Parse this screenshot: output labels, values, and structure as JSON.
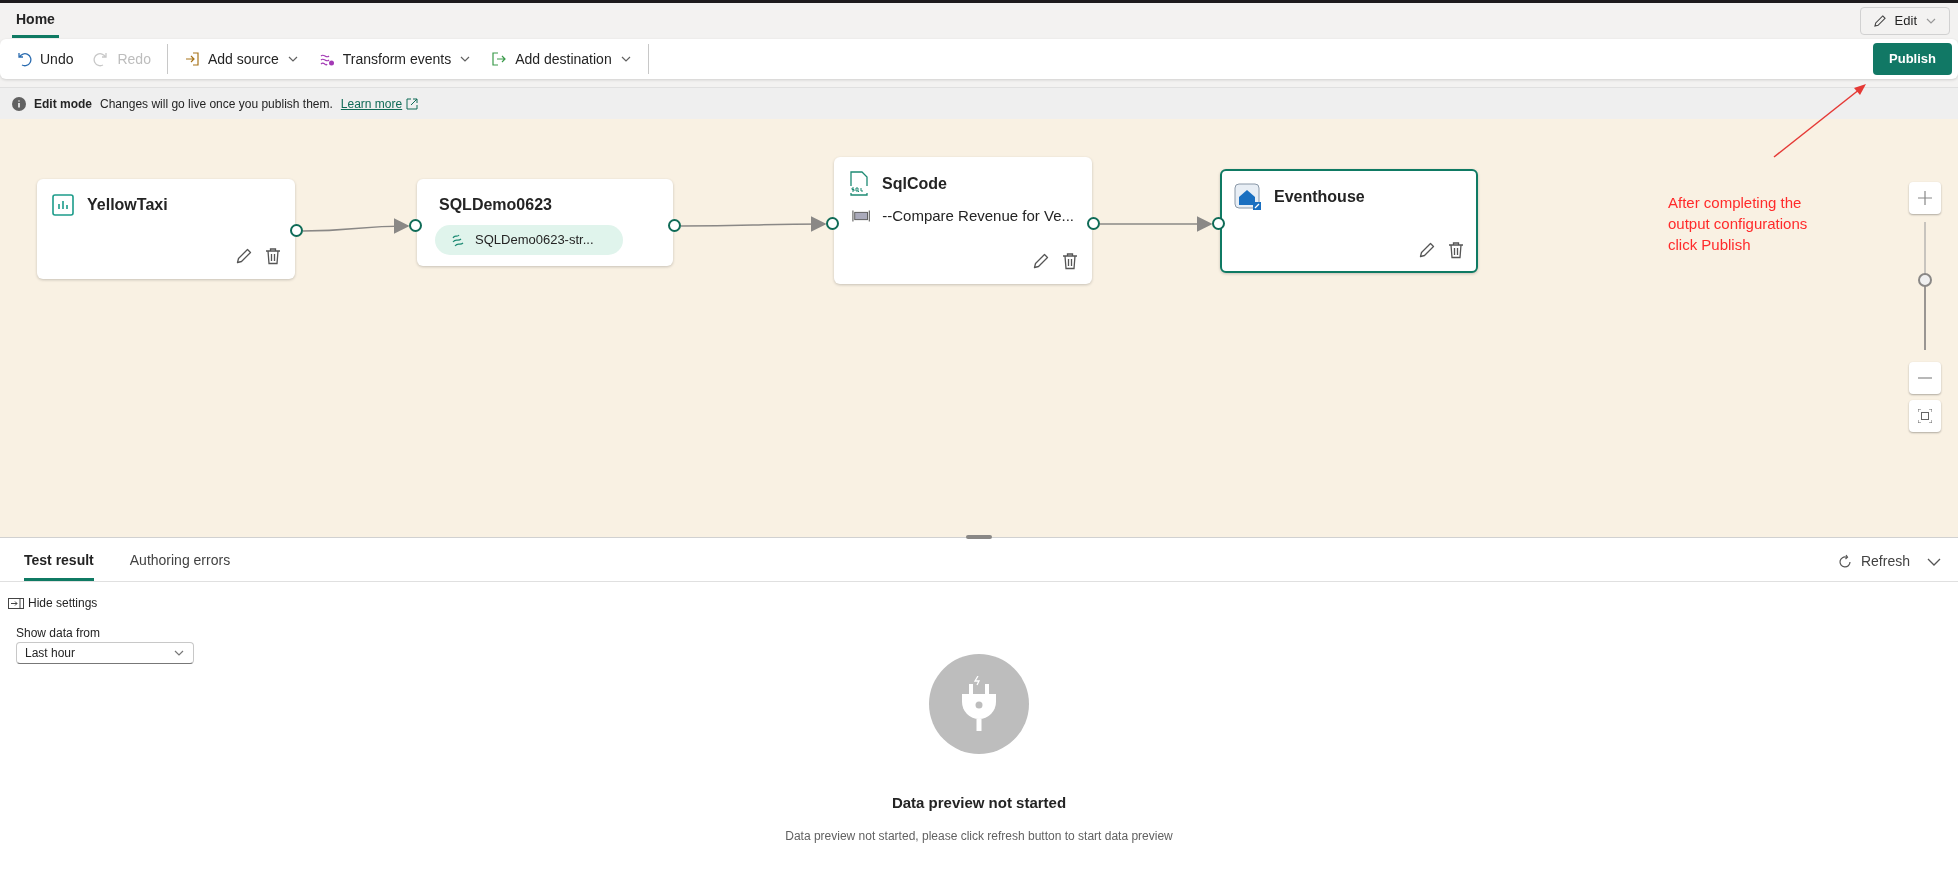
{
  "tabs": [
    {
      "label": "Home",
      "selected": true
    }
  ],
  "edit_button": {
    "label": "Edit"
  },
  "toolbar": {
    "groups": [
      [
        {
          "kind": "undo",
          "label": "Undo",
          "disabled": false,
          "dropdown": false
        },
        {
          "kind": "redo",
          "label": "Redo",
          "disabled": true,
          "dropdown": false
        }
      ],
      [
        {
          "kind": "source",
          "label": "Add source",
          "disabled": false,
          "dropdown": true
        },
        {
          "kind": "transform",
          "label": "Transform events",
          "disabled": false,
          "dropdown": true
        },
        {
          "kind": "destination",
          "label": "Add destination",
          "disabled": false,
          "dropdown": true
        }
      ]
    ],
    "publish": "Publish"
  },
  "info_bar": {
    "title": "Edit mode",
    "message": "Changes will go live once you publish them.",
    "link": "Learn more"
  },
  "canvas": {
    "nodes": [
      {
        "kind": "source",
        "title": "YellowTaxi",
        "selected": false,
        "actions": true
      },
      {
        "kind": "stream",
        "title": "SQLDemo0623",
        "chip": "SQLDemo0623-str...",
        "selected": false,
        "actions": false
      },
      {
        "kind": "operator",
        "title": "SqlCode",
        "code": "--Compare Revenue for Ve...",
        "selected": false,
        "actions": true
      },
      {
        "kind": "destination",
        "title": "Eventhouse",
        "selected": true,
        "actions": true
      }
    ],
    "zoom": {
      "level": 0.55
    }
  },
  "annotation": {
    "lines": [
      "After completing the",
      "output configurations",
      "click Publish"
    ]
  },
  "bottom_panel": {
    "tabs": [
      {
        "label": "Test result",
        "selected": true
      },
      {
        "label": "Authoring errors",
        "selected": false
      }
    ],
    "refresh": "Refresh",
    "hide_settings": "Hide settings",
    "show_data_from": {
      "label": "Show data from",
      "value": "Last hour"
    },
    "empty_state": {
      "title": "Data preview not started",
      "message": "Data preview not started, please click refresh button to start data preview"
    }
  }
}
